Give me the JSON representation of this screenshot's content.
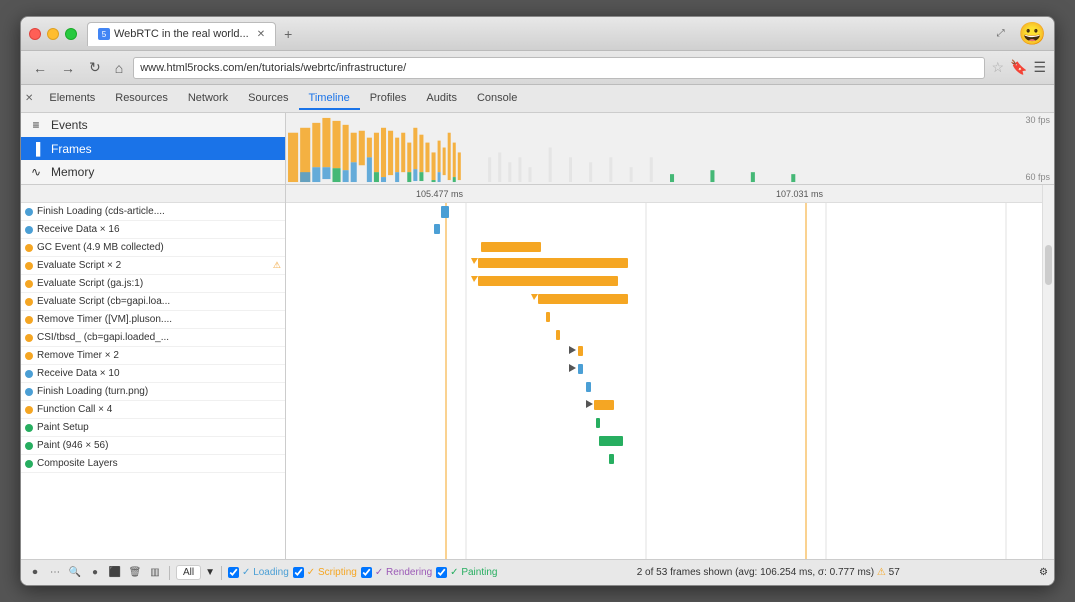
{
  "window": {
    "title": "WebRTC in the real world...",
    "url": "www.html5rocks.com/en/tutorials/webrtc/infrastructure/",
    "emoji": "😀"
  },
  "nav_tabs": {
    "close": "✕",
    "tab_icon": "5",
    "tab_title": "WebRTC in the real world...",
    "new_tab": "+"
  },
  "nav_buttons": {
    "back": "←",
    "forward": "→",
    "reload": "↻",
    "home": "⌂",
    "star": "☆",
    "bookmark": "🔖",
    "menu": "☰",
    "resize": "⤢"
  },
  "devtools": {
    "close": "✕",
    "tabs": [
      "Elements",
      "Resources",
      "Network",
      "Sources",
      "Timeline",
      "Profiles",
      "Audits",
      "Console"
    ],
    "active_tab": "Timeline"
  },
  "left_panel": {
    "items": [
      {
        "id": "events",
        "label": "Events",
        "icon": "≡"
      },
      {
        "id": "frames",
        "label": "Frames",
        "icon": "▐",
        "selected": true
      },
      {
        "id": "memory",
        "label": "Memory",
        "icon": "∿"
      }
    ]
  },
  "fps_labels": {
    "fps30": "30 fps",
    "fps60": "60 fps"
  },
  "time_labels": {
    "t1": "105.477 ms",
    "t2": "107.031 ms"
  },
  "events": [
    {
      "color": "#4b9fd5",
      "label": "Finish Loading (cds-article...."
    },
    {
      "color": "#4b9fd5",
      "label": "Receive Data × 16"
    },
    {
      "color": "#f5a623",
      "label": "GC Event (4.9 MB collected)"
    },
    {
      "color": "#f5a623",
      "label": "Evaluate Script × 2",
      "warning": true
    },
    {
      "color": "#f5a623",
      "label": "Evaluate Script (ga.js:1)"
    },
    {
      "color": "#f5a623",
      "label": "Evaluate Script (cb=gapi.loa..."
    },
    {
      "color": "#f5a623",
      "label": "Remove Timer ([VM].pluson...."
    },
    {
      "color": "#f5a623",
      "label": "CSI/tbsd_ (cb=gapi.loaded_..."
    },
    {
      "color": "#f5a623",
      "label": "Remove Timer × 2"
    },
    {
      "color": "#4b9fd5",
      "label": "Receive Data × 10"
    },
    {
      "color": "#4b9fd5",
      "label": "Finish Loading (turn.png)"
    },
    {
      "color": "#f5a623",
      "label": "Function Call × 4"
    },
    {
      "color": "#27ae60",
      "label": "Paint Setup"
    },
    {
      "color": "#27ae60",
      "label": "Paint (946 × 56)"
    },
    {
      "color": "#27ae60",
      "label": "Composite Layers"
    }
  ],
  "status_bar": {
    "filter_label": "All",
    "checkboxes": [
      {
        "label": "Loading",
        "color": "#4b9fd5",
        "checked": true
      },
      {
        "label": "Scripting",
        "color": "#f5a623",
        "checked": true
      },
      {
        "label": "Rendering",
        "color": "#9b59b6",
        "checked": true
      },
      {
        "label": "Painting",
        "color": "#27ae60",
        "checked": true
      }
    ],
    "info": "2 of 53 frames shown (avg: 106.254 ms, σ: 0.777 ms)",
    "warning_count": "57",
    "gear": "⚙"
  }
}
